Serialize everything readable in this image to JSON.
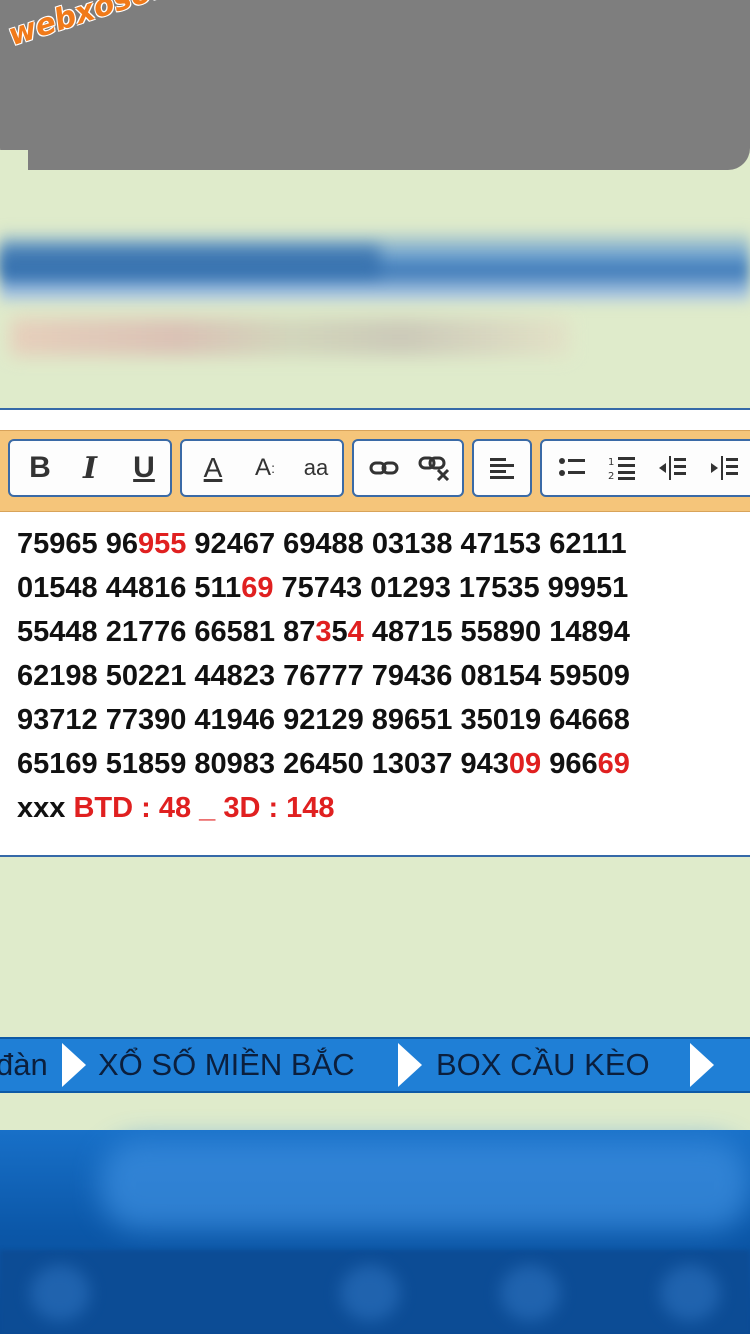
{
  "logo": {
    "text": "webxoso.net"
  },
  "toolbar": {
    "bold": "B",
    "italic": "I",
    "underline": "U",
    "font_color": "A",
    "font_size": "A",
    "font_case": "aa"
  },
  "editor": {
    "rows": [
      [
        [
          "75965 96",
          ""
        ],
        [
          "95",
          "r"
        ],
        [
          "5",
          "r"
        ],
        [
          " 92467 69488 03138 47153 62111",
          ""
        ]
      ],
      [
        [
          "01548 44816 511",
          ""
        ],
        [
          "6",
          "r"
        ],
        [
          "9",
          "r"
        ],
        [
          " 75743 01293 17535 99951",
          ""
        ]
      ],
      [
        [
          "55448 21776 66581 87",
          ""
        ],
        [
          "3",
          "r"
        ],
        [
          "5",
          ""
        ],
        [
          "4",
          "r"
        ],
        [
          " 48715 55890 14894",
          ""
        ]
      ],
      [
        [
          "62198 50221 44823 76777 79436 08154 59509",
          ""
        ]
      ],
      [
        [
          "93712 77390 41946 92129 89651 35019 64668",
          ""
        ]
      ],
      [
        [
          "65169 51859 80983 26450 13037 943",
          ""
        ],
        [
          "09",
          "r"
        ],
        [
          " 966",
          ""
        ],
        [
          "69",
          "r"
        ]
      ],
      [
        [
          "xxx ",
          ""
        ],
        [
          "BTD : 48 _ 3D : 148",
          "r"
        ]
      ]
    ]
  },
  "nav": {
    "item1": "đàn",
    "item2": "XỔ SỐ MIỀN BẮC",
    "item3": "BOX CẦU KÈO"
  },
  "colors": {
    "accent_red": "#e02020",
    "nav_blue": "#1f7fd6",
    "bg_green": "#dfebcb"
  }
}
